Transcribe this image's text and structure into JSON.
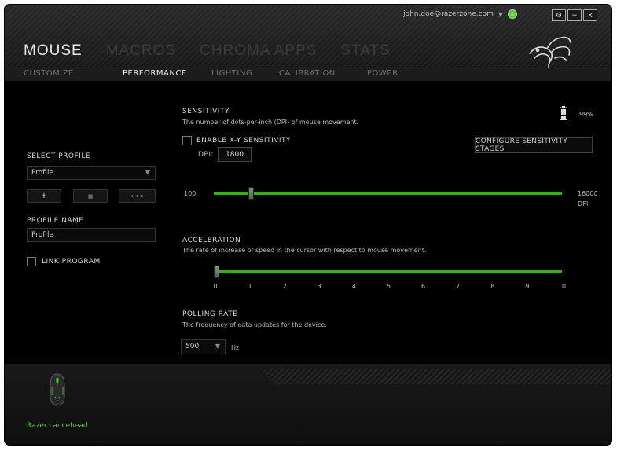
{
  "header": {
    "user_email": "john.doe@razerzone.com",
    "main_tabs": [
      "MOUSE",
      "MACROS",
      "CHROMA APPS",
      "STATS"
    ],
    "sub_tabs": [
      "CUSTOMIZE",
      "PERFORMANCE",
      "LIGHTING",
      "CALIBRATION",
      "POWER"
    ],
    "window_controls": [
      "⚙",
      "−",
      "x"
    ]
  },
  "left": {
    "select_profile_label": "SELECT PROFILE",
    "profile_selected": "Profile",
    "add_button": "+",
    "delete_button": "■",
    "more_button": "• • •",
    "profile_name_label": "PROFILE NAME",
    "profile_name_value": "Profile",
    "link_program_label": "LINK PROGRAM"
  },
  "sensitivity": {
    "title": "SENSITIVITY",
    "desc": "The number of dots-per-inch (DPI) of mouse movement.",
    "enable_xy_label": "ENABLE X-Y SENSITIVITY",
    "dpi_label": "DPI:",
    "dpi_value": "1800",
    "configure_button": "CONFIGURE SENSITIVITY STAGES",
    "min_label": "100",
    "max_label": "16000",
    "max_unit": "DPI",
    "min": 100,
    "max": 16000,
    "value": 1800
  },
  "battery": {
    "percent_label": "99%"
  },
  "acceleration": {
    "title": "ACCELERATION",
    "desc": "The rate of increase of speed in the cursor with respect to mouse movement.",
    "ticks": [
      "0",
      "1",
      "2",
      "3",
      "4",
      "5",
      "6",
      "7",
      "8",
      "9",
      "10"
    ],
    "value": 0
  },
  "polling": {
    "title": "POLLING RATE",
    "desc": "The frequency of data updates for the device.",
    "value": "500",
    "unit": "Hz"
  },
  "footer": {
    "device_name": "Razer Lancehead"
  },
  "colors": {
    "accent": "#44d62c",
    "slider": "#3aae1f"
  }
}
